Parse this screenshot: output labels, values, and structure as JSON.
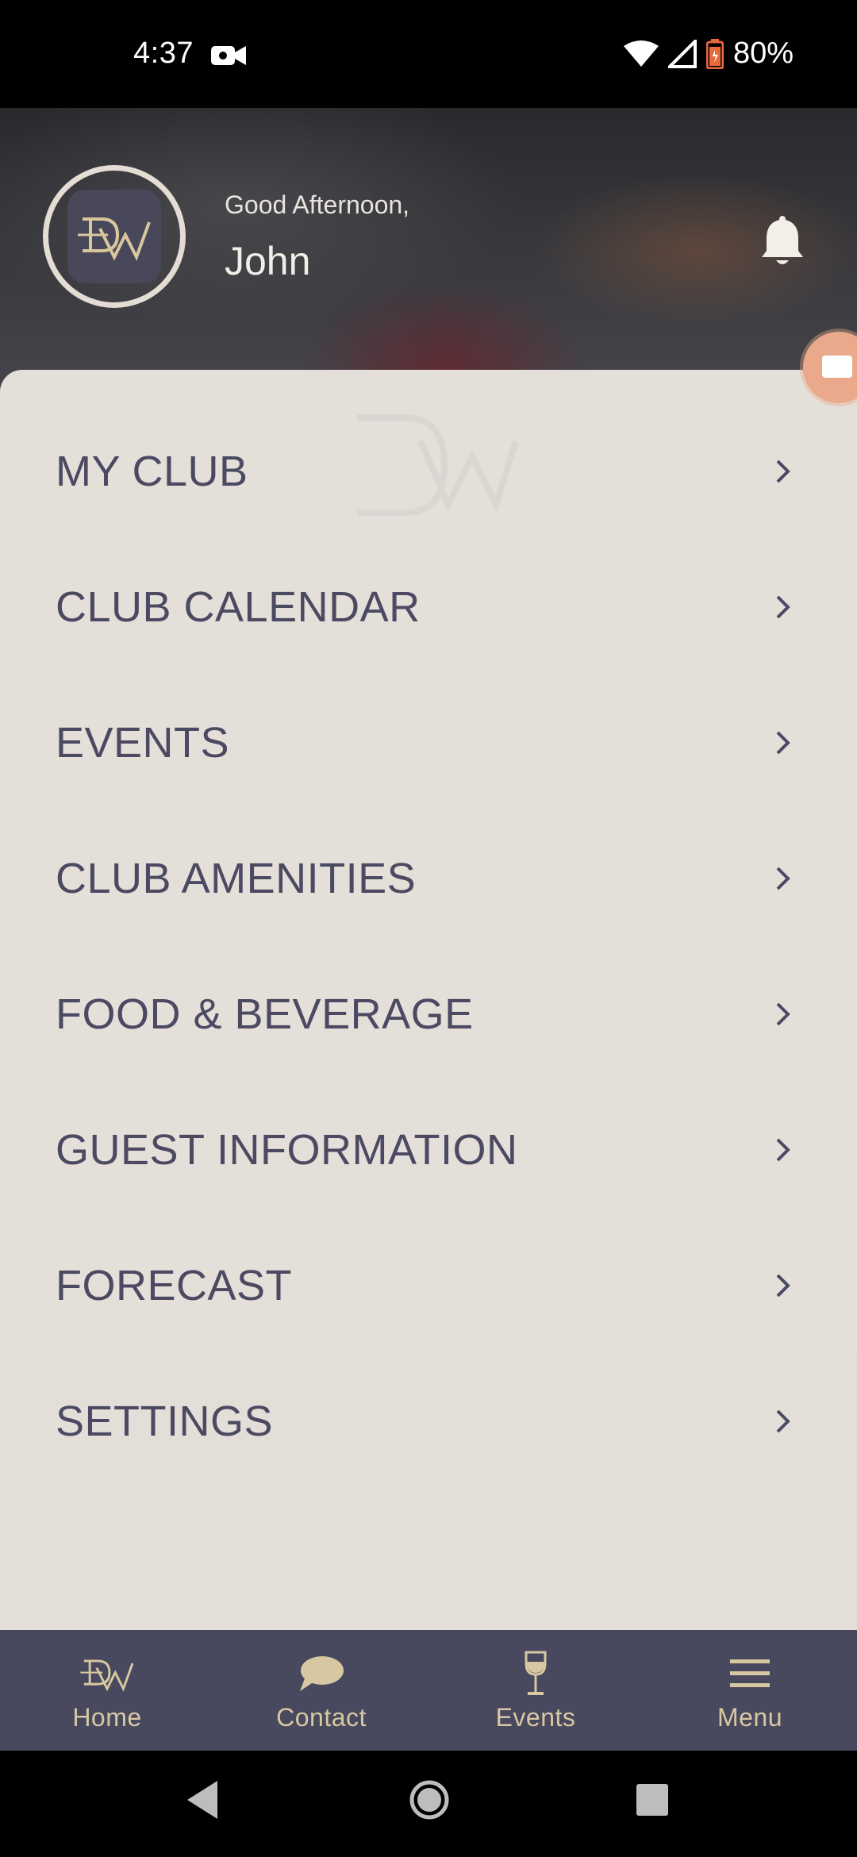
{
  "status": {
    "time": "4:37",
    "battery": "80%"
  },
  "header": {
    "greeting": "Good Afternoon,",
    "name": "John",
    "logo_text": "DW"
  },
  "menu": {
    "items": [
      {
        "label": "MY CLUB"
      },
      {
        "label": "CLUB CALENDAR"
      },
      {
        "label": "EVENTS"
      },
      {
        "label": "CLUB AMENITIES"
      },
      {
        "label": "FOOD & BEVERAGE"
      },
      {
        "label": "GUEST INFORMATION"
      },
      {
        "label": "FORECAST"
      },
      {
        "label": "SETTINGS"
      }
    ]
  },
  "bottom_nav": {
    "items": [
      {
        "label": "Home",
        "icon": "dw-logo-icon"
      },
      {
        "label": "Contact",
        "icon": "chat-bubble-icon"
      },
      {
        "label": "Events",
        "icon": "wine-glass-icon"
      },
      {
        "label": "Menu",
        "icon": "hamburger-icon"
      }
    ]
  },
  "colors": {
    "menu_bg": "#e4dfd9",
    "menu_text": "#4b4a62",
    "nav_bg": "#48485e",
    "nav_accent": "#d7c8a2"
  }
}
